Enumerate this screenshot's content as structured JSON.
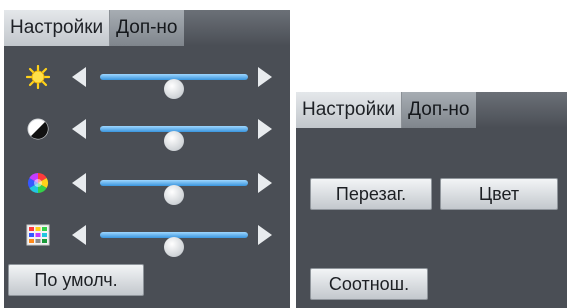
{
  "left_panel": {
    "tabs": [
      {
        "label": "Настройки",
        "active": true
      },
      {
        "label": "Доп-но",
        "active": false
      }
    ],
    "sliders": [
      {
        "icon": "brightness-icon",
        "value": 0.5
      },
      {
        "icon": "contrast-icon",
        "value": 0.5
      },
      {
        "icon": "color-wheel-icon",
        "value": 0.5
      },
      {
        "icon": "color-grid-icon",
        "value": 0.5
      }
    ],
    "default_button": "По умолч."
  },
  "right_panel": {
    "tabs": [
      {
        "label": "Настройки",
        "active": true
      },
      {
        "label": "Доп-но",
        "active": false
      }
    ],
    "reboot_button": "Перезаг.",
    "color_button": "Цвет",
    "aspect_button": "Соотнош."
  },
  "colors": {
    "panel_bg": "#4a4e55",
    "slider_track": "#3a95dd",
    "sun_icon": "#ffd21a"
  }
}
